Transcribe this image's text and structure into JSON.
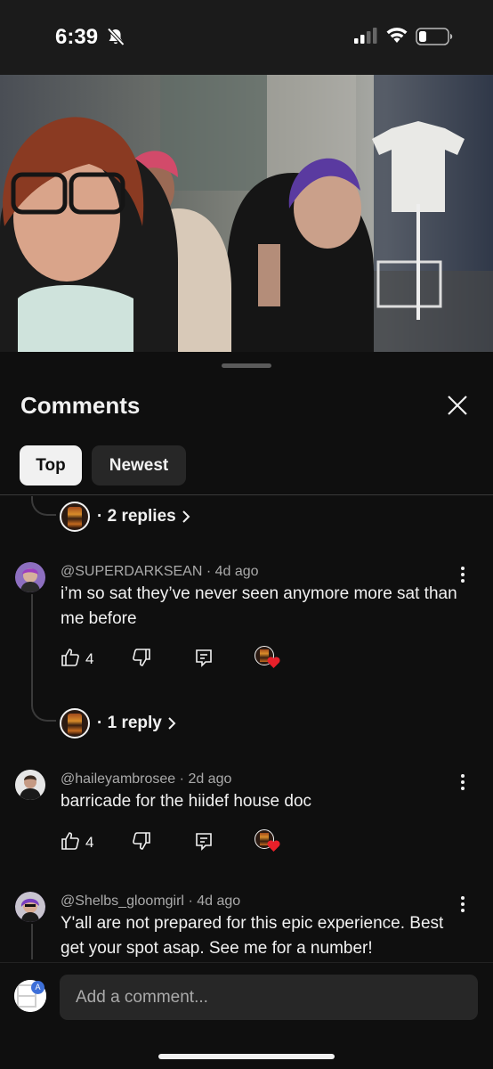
{
  "status_bar": {
    "time": "6:39",
    "icons": [
      "bell-slash-icon",
      "cellular-signal-icon",
      "wifi-icon",
      "battery-icon"
    ]
  },
  "video": {
    "description_icon": "video-player"
  },
  "comments_panel": {
    "title": "Comments",
    "close_icon": "close-icon",
    "chips": [
      {
        "label": "Top",
        "selected": true
      },
      {
        "label": "Newest",
        "selected": false
      }
    ]
  },
  "threads": [
    {
      "reply_link": "· 2 replies"
    },
    {
      "author": "@SUPERDARKSEAN",
      "time": "4d ago",
      "text": "i’m so sat they’ve never seen anymore more sat than me before",
      "likes": "4",
      "reply_link": "· 1 reply"
    },
    {
      "author": "@haileyambrosee",
      "time": "2d ago",
      "text": "barricade for the hiidef house doc",
      "likes": "4"
    },
    {
      "author": "@Shelbs_gloomgirl",
      "time": "4d ago",
      "text": "Y'all are not prepared for this epic experience. Best get your spot asap. See me for a number!"
    }
  ],
  "composer": {
    "avatar_letter": "A",
    "placeholder": "Add a comment..."
  },
  "colors": {
    "background": "#0f0f0f",
    "chip_selected": "#f1f1f1",
    "chip": "#272727",
    "secondary_text": "#aaaaaa",
    "heart": "#e8202a"
  }
}
